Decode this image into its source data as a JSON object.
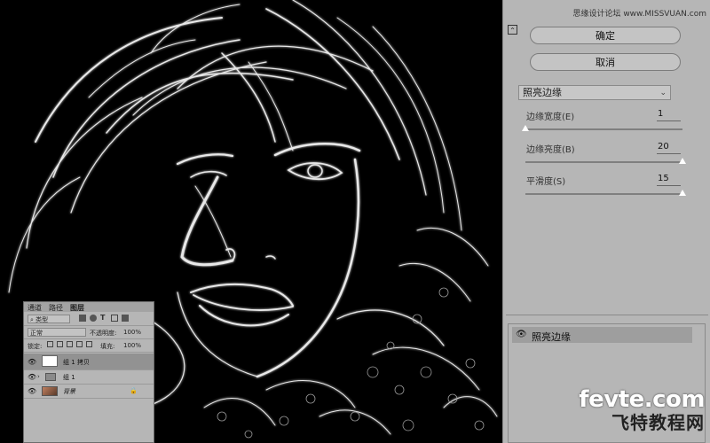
{
  "watermark_top": "思缘设计论坛 www.MISSVUAN.com",
  "panel": {
    "ok_label": "确定",
    "cancel_label": "取消",
    "filter_name": "照亮边缘",
    "params": [
      {
        "label": "边缘宽度(E)",
        "value": "1",
        "fraction": 0.0
      },
      {
        "label": "边缘亮度(B)",
        "value": "20",
        "fraction": 1.0
      },
      {
        "label": "平滑度(S)",
        "value": "15",
        "fraction": 1.0
      }
    ],
    "effect_layer_name": "照亮边缘"
  },
  "layers": {
    "tabs": [
      "通道",
      "路径",
      "图层"
    ],
    "kind_label": "类型",
    "blend_mode": "正常",
    "opacity_label": "不透明度:",
    "opacity_value": "100%",
    "lock_label": "锁定:",
    "fill_label": "填充:",
    "fill_value": "100%",
    "items": [
      {
        "name": "组 1 拷贝"
      },
      {
        "name": "组 1"
      },
      {
        "name": "背景"
      }
    ]
  },
  "brand": {
    "url": "fevte.com",
    "cn": "飞特教程网"
  },
  "colors": {
    "panel_bg": "#b6b6b6",
    "canvas_bg": "#000000"
  }
}
